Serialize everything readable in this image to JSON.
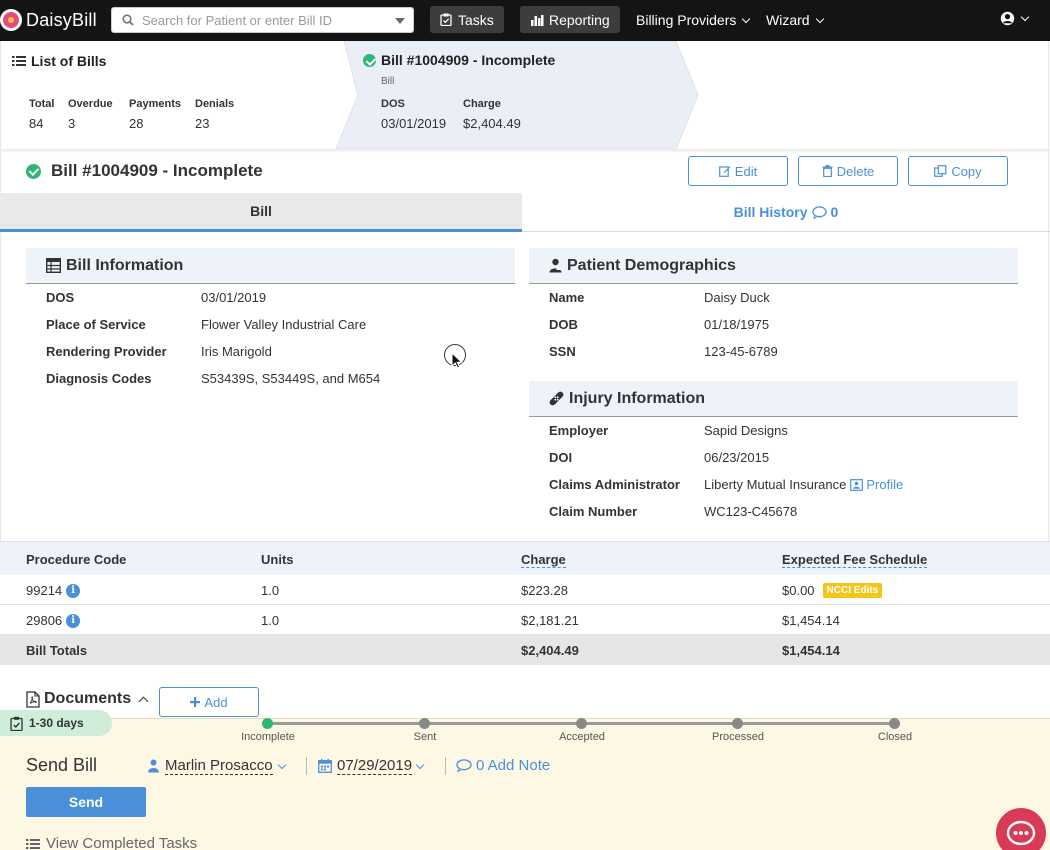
{
  "app": {
    "name": "DaisyBill"
  },
  "nav": {
    "search_placeholder": "Search for Patient or enter Bill ID",
    "tasks": "Tasks",
    "reporting": "Reporting",
    "billing_providers": "Billing Providers",
    "wizard": "Wizard"
  },
  "list_panel": {
    "title": "List of Bills",
    "stats": [
      {
        "label": "Total",
        "value": "84"
      },
      {
        "label": "Overdue",
        "value": "3"
      },
      {
        "label": "Payments",
        "value": "28"
      },
      {
        "label": "Denials",
        "value": "23"
      }
    ]
  },
  "bill_panel": {
    "title": "Bill #1004909 - Incomplete",
    "subtitle": "Bill",
    "dos_label": "DOS",
    "dos_value": "03/01/2019",
    "charge_label": "Charge",
    "charge_value": "$2,404.49"
  },
  "bill_header": {
    "title": "Bill #1004909 - Incomplete",
    "edit": "Edit",
    "delete": "Delete",
    "copy": "Copy"
  },
  "tabs": {
    "bill": "Bill",
    "history": "Bill History",
    "history_count": "0"
  },
  "bill_info": {
    "title": "Bill Information",
    "rows": [
      {
        "label": "DOS",
        "value": "03/01/2019"
      },
      {
        "label": "Place of Service",
        "value": "Flower Valley Industrial Care"
      },
      {
        "label": "Rendering Provider",
        "value": "Iris Marigold"
      },
      {
        "label": "Diagnosis Codes",
        "value": "S53439S, S53449S, and M654"
      }
    ]
  },
  "patient": {
    "title": "Patient Demographics",
    "rows": [
      {
        "label": "Name",
        "value": "Daisy Duck"
      },
      {
        "label": "DOB",
        "value": "01/18/1975"
      },
      {
        "label": "SSN",
        "value": "123-45-6789"
      }
    ]
  },
  "injury": {
    "title": "Injury Information",
    "rows": [
      {
        "label": "Employer",
        "value": "Sapid Designs"
      },
      {
        "label": "DOI",
        "value": "06/23/2015"
      },
      {
        "label": "Claims Administrator",
        "value": "Liberty Mutual Insurance"
      },
      {
        "label": "Claim Number",
        "value": "WC123-C45678"
      }
    ],
    "profile_link": "Profile"
  },
  "procedures": {
    "headers": [
      "Procedure Code",
      "Units",
      "Charge",
      "Expected Fee Schedule"
    ],
    "rows": [
      {
        "code": "99214",
        "units": "1.0",
        "charge": "$223.28",
        "fee": "$0.00",
        "badge": "NCCI Edits"
      },
      {
        "code": "29806",
        "units": "1.0",
        "charge": "$2,181.21",
        "fee": "$1,454.14",
        "badge": ""
      }
    ],
    "totals": {
      "label": "Bill Totals",
      "charge": "$2,404.49",
      "fee": "$1,454.14"
    }
  },
  "documents": {
    "title": "Documents",
    "add": "Add"
  },
  "task": {
    "days": "1-30 days",
    "steps": [
      "Incomplete",
      "Sent",
      "Accepted",
      "Processed",
      "Closed"
    ],
    "current_step": 0,
    "title": "Send Bill",
    "assignee": "Marlin Prosacco",
    "due": "07/29/2019",
    "note": "0 Add Note",
    "send": "Send",
    "view_completed": "View Completed Tasks"
  },
  "colors": {
    "accent": "#4a90d9",
    "success": "#2fb673",
    "warning": "#f5c518",
    "chat": "#d93a55"
  }
}
